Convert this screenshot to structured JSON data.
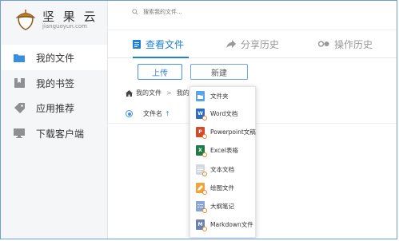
{
  "app": {
    "brand_name": "坚 果 云",
    "domain": "jianguoyun.com"
  },
  "sidebar": {
    "items": [
      {
        "label": "我的文件",
        "icon": "folder-icon",
        "active": true
      },
      {
        "label": "我的书签",
        "icon": "bookmark-icon",
        "active": false
      },
      {
        "label": "应用推荐",
        "icon": "tag-icon",
        "active": false
      },
      {
        "label": "下载客户端",
        "icon": "monitor-icon",
        "active": false
      }
    ]
  },
  "search": {
    "placeholder": "搜索我的文件..."
  },
  "tabs": [
    {
      "label": "查看文件",
      "icon": "document-icon",
      "active": true
    },
    {
      "label": "分享历史",
      "icon": "share-icon",
      "active": false
    },
    {
      "label": "操作历史",
      "icon": "history-icon",
      "active": false
    }
  ],
  "toolbar": {
    "upload_label": "上传",
    "new_label": "新建"
  },
  "breadcrumb": {
    "root": "我的文件",
    "separator": ">",
    "next": "我的"
  },
  "columns": {
    "filename": "文件名",
    "sort_arrow": "↑"
  },
  "new_menu": {
    "items": [
      {
        "label": "文件夹",
        "icon": "new-folder-icon",
        "color": "#5aa4e8",
        "glyph": ""
      },
      {
        "label": "Word文档",
        "icon": "word-icon",
        "color": "#2b6cc4",
        "glyph": "W"
      },
      {
        "label": "Powerpoint文稿",
        "icon": "powerpoint-icon",
        "color": "#d04a2b",
        "glyph": "P"
      },
      {
        "label": "Excel表格",
        "icon": "excel-icon",
        "color": "#1f7a45",
        "glyph": "X"
      },
      {
        "label": "文本文档",
        "icon": "text-doc-icon",
        "color": "#cfd3d8",
        "glyph": ""
      },
      {
        "label": "绘图文件",
        "icon": "drawing-icon",
        "color": "#f1a43a",
        "glyph": ""
      },
      {
        "label": "大纲笔记",
        "icon": "outline-note-icon",
        "color": "#8aa4d6",
        "glyph": ""
      },
      {
        "label": "Markdown文件",
        "icon": "markdown-icon",
        "color": "#6b82b3",
        "glyph": "M"
      }
    ]
  },
  "colors": {
    "accent": "#1f80d8"
  }
}
